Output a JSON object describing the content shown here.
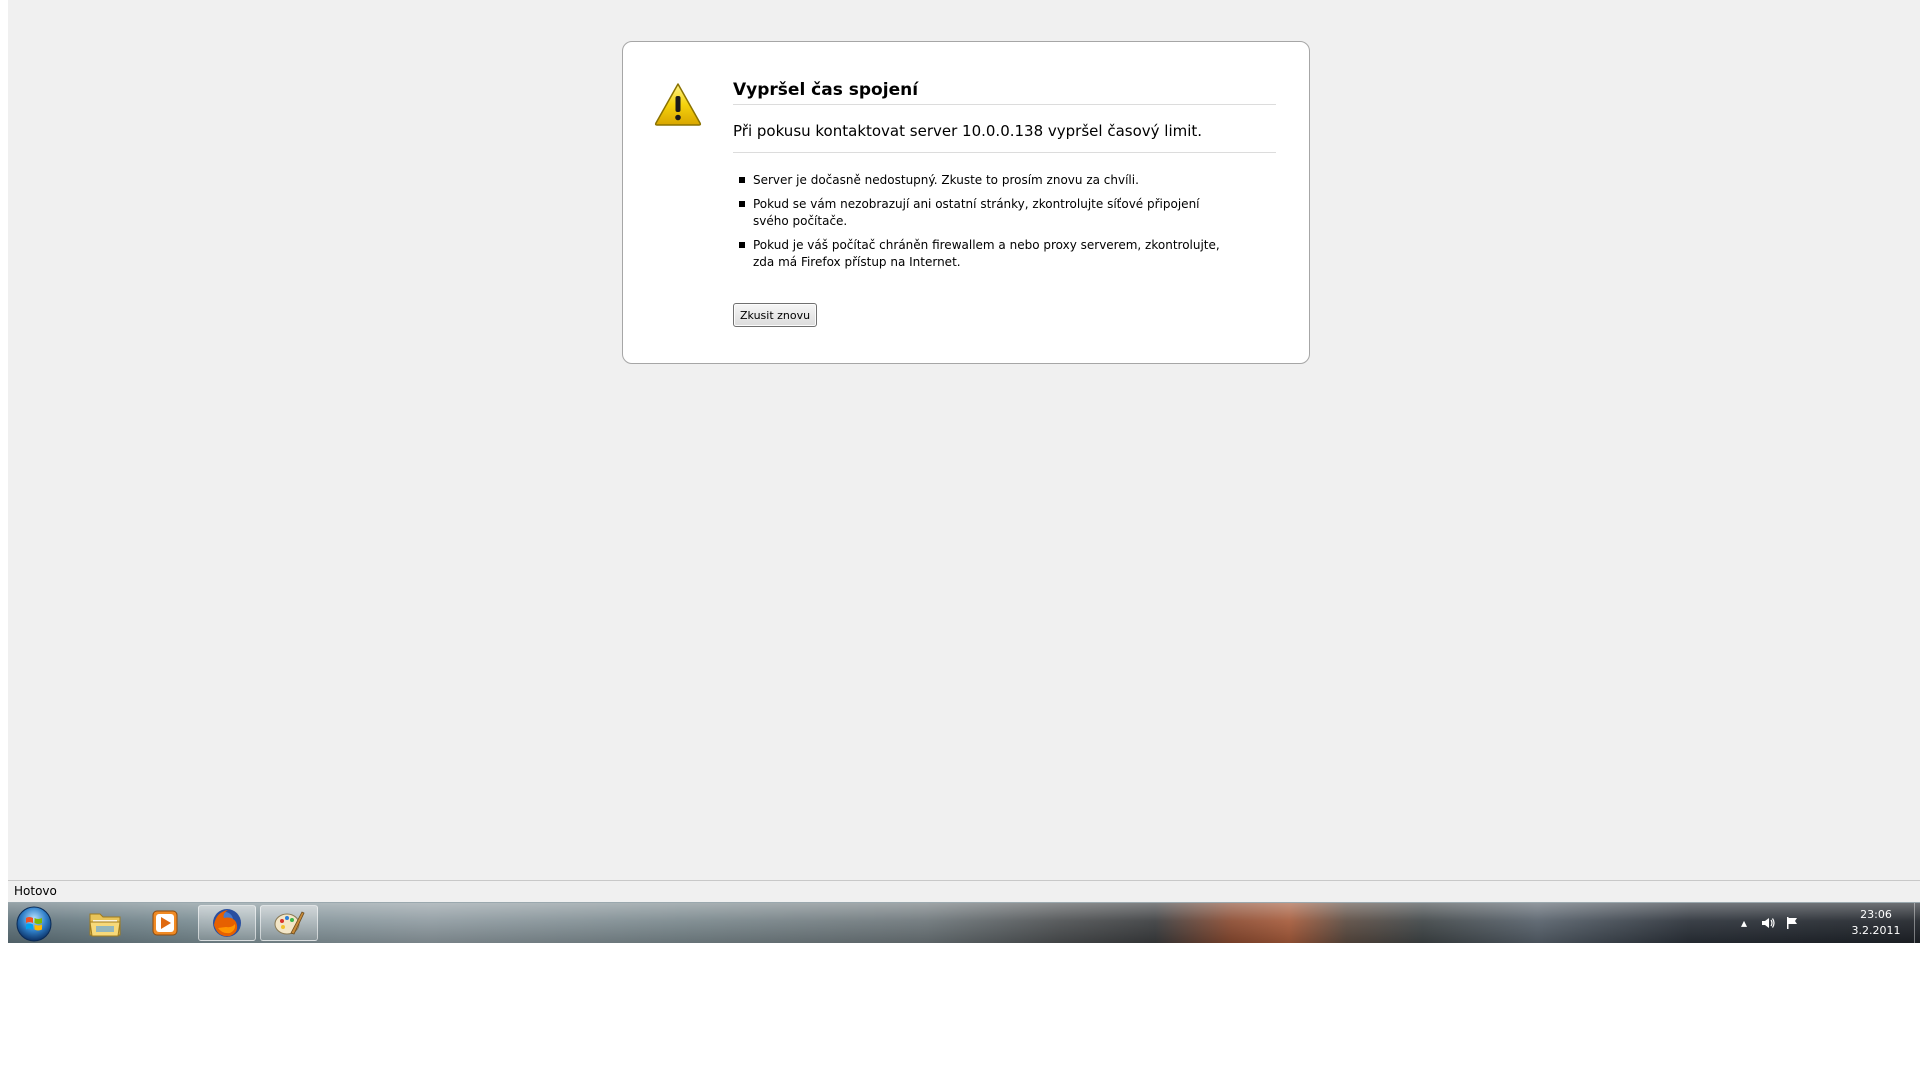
{
  "error": {
    "title": "Vypršel čas spojení",
    "message": "Při pokusu kontaktovat server 10.0.0.138 vypršel časový limit.",
    "suggestions": [
      "Server je dočasně nedostupný. Zkuste to prosím znovu za chvíli.",
      "Pokud se vám nezobrazují ani ostatní stránky, zkontrolujte síťové připojení svého počítače.",
      "Pokud je váš počítač chráněn firewallem a nebo proxy serverem, zkontrolujte, zda má Firefox přístup na Internet."
    ],
    "retry_label": "Zkusit znovu",
    "icon": "warning-icon"
  },
  "statusbar": {
    "text": "Hotovo"
  },
  "taskbar": {
    "start_icon": "windows-start-icon",
    "pinned": [
      {
        "name": "explorer",
        "icon": "folder-icon",
        "active": false
      },
      {
        "name": "media-player",
        "icon": "media-player-icon",
        "active": false
      },
      {
        "name": "firefox",
        "icon": "firefox-icon",
        "active": true
      },
      {
        "name": "paint",
        "icon": "paint-icon",
        "active": true
      }
    ],
    "tray": {
      "icons": [
        "show-hidden-icons-icon",
        "volume-icon",
        "action-center-flag-icon"
      ],
      "time": "23:06",
      "date": "3.2.2011"
    }
  },
  "colors": {
    "page_background": "#f0f0f0",
    "box_border": "#a6a6a6",
    "warning_yellow": "#f5d20c"
  }
}
